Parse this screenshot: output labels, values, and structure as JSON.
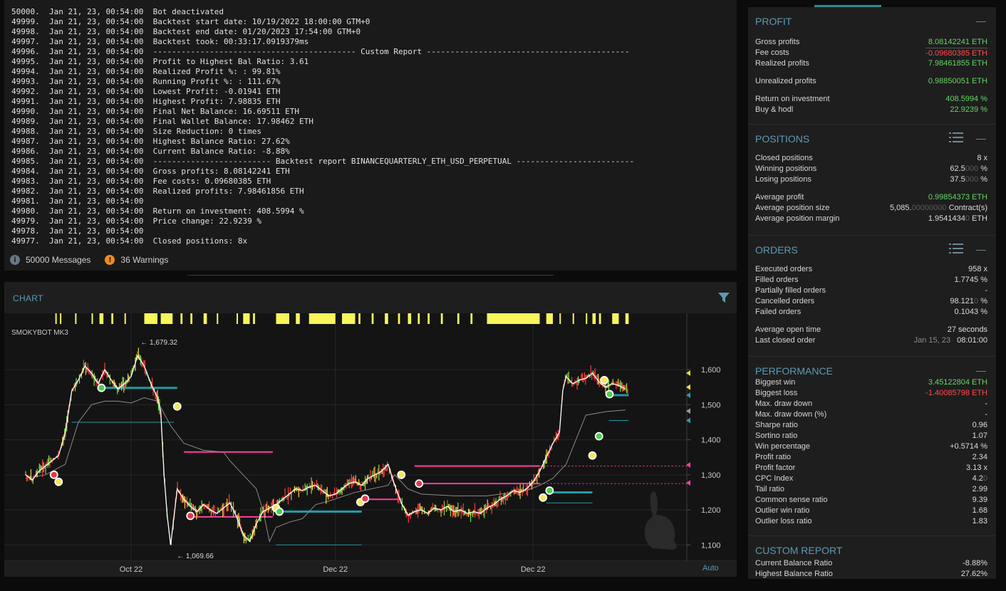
{
  "console": {
    "lines": [
      "50000.  Jan 21, 23, 00:54:00  Bot deactivated",
      "49999.  Jan 21, 23, 00:54:00  Backtest start date: 10/19/2022 18:00:00 GTM+0",
      "49998.  Jan 21, 23, 00:54:00  Backtest end date: 01/20/2023 17:54:00 GTM+0",
      "49997.  Jan 21, 23, 00:54:00  Backtest took: 00:33:17.0919379ms",
      "49996.  Jan 21, 23, 00:54:00  ------------------------------------------- Custom Report -------------------------------------------",
      "49995.  Jan 21, 23, 00:54:00  Profit to Highest Bal Ratio: 3.61",
      "49994.  Jan 21, 23, 00:54:00  Realized Profit %: : 99.81%",
      "49993.  Jan 21, 23, 00:54:00  Running Profit %: : 111.67%",
      "49992.  Jan 21, 23, 00:54:00  Lowest Profit: -0.01941 ETH",
      "49991.  Jan 21, 23, 00:54:00  Highest Profit: 7.98835 ETH",
      "49990.  Jan 21, 23, 00:54:00  Final Net Balance: 16.69511 ETH",
      "49989.  Jan 21, 23, 00:54:00  Final Wallet Balance: 17.98462 ETH",
      "49988.  Jan 21, 23, 00:54:00  Size Reduction: 0 times",
      "49987.  Jan 21, 23, 00:54:00  Highest Balance Ratio: 27.62%",
      "49986.  Jan 21, 23, 00:54:00  Current Balance Ratio: -8.88%",
      "49985.  Jan 21, 23, 00:54:00  ------------------------- Backtest report BINANCEQUARTERLY_ETH_USD_PERPETUAL -------------------------",
      "49984.  Jan 21, 23, 00:54:00  Gross profits: 8.08142241 ETH",
      "49983.  Jan 21, 23, 00:54:00  Fee costs: 0.09680385 ETH",
      "49982.  Jan 21, 23, 00:54:00  Realized profits: 7.98461856 ETH",
      "49981.  Jan 21, 23, 00:54:00",
      "49980.  Jan 21, 23, 00:54:00  Return on investment: 408.5994 %",
      "49979.  Jan 21, 23, 00:54:00  Price change: 22.9239 %",
      "49978.  Jan 21, 23, 00:54:00",
      "49977.  Jan 21, 23, 00:54:00  Closed positions: 8x"
    ],
    "messages_label": "50000 Messages",
    "warnings_label": "36 Warnings"
  },
  "chart_panel": {
    "title": "CHART",
    "strategy": "SMOKYBOT MK3",
    "auto_label": "Auto",
    "high_label": "← 1,679.32",
    "low_label": "← 1,069.66"
  },
  "chart_data": {
    "type": "line",
    "title": "SMOKYBOT MK3",
    "ylim": [
      1060,
      1720
    ],
    "y_ticks": [
      1100,
      1200,
      1300,
      1400,
      1500,
      1600
    ],
    "y_tick_labels": [
      "1,100",
      "1,200",
      "1,300",
      "1,400",
      "1,500",
      "1,600"
    ],
    "x_tick_labels": [
      "Oct 22",
      "Dec 22",
      "Dec 22"
    ],
    "x_tick_positions": [
      0.16,
      0.47,
      0.77
    ],
    "annotations": {
      "high": 1679.32,
      "low": 1069.66
    },
    "price_series": [
      [
        0.0,
        1300
      ],
      [
        0.01,
        1285
      ],
      [
        0.02,
        1310
      ],
      [
        0.03,
        1325
      ],
      [
        0.04,
        1340
      ],
      [
        0.05,
        1355
      ],
      [
        0.06,
        1420
      ],
      [
        0.07,
        1540
      ],
      [
        0.08,
        1570
      ],
      [
        0.09,
        1610
      ],
      [
        0.1,
        1590
      ],
      [
        0.11,
        1560
      ],
      [
        0.12,
        1600
      ],
      [
        0.13,
        1570
      ],
      [
        0.14,
        1545
      ],
      [
        0.15,
        1560
      ],
      [
        0.16,
        1580
      ],
      [
        0.17,
        1640
      ],
      [
        0.18,
        1610
      ],
      [
        0.19,
        1560
      ],
      [
        0.2,
        1520
      ],
      [
        0.205,
        1480
      ],
      [
        0.21,
        1300
      ],
      [
        0.215,
        1180
      ],
      [
        0.22,
        1100
      ],
      [
        0.23,
        1260
      ],
      [
        0.24,
        1230
      ],
      [
        0.25,
        1210
      ],
      [
        0.26,
        1195
      ],
      [
        0.27,
        1215
      ],
      [
        0.28,
        1200
      ],
      [
        0.29,
        1190
      ],
      [
        0.3,
        1205
      ],
      [
        0.31,
        1220
      ],
      [
        0.32,
        1180
      ],
      [
        0.33,
        1130
      ],
      [
        0.34,
        1110
      ],
      [
        0.35,
        1160
      ],
      [
        0.36,
        1195
      ],
      [
        0.37,
        1205
      ],
      [
        0.38,
        1215
      ],
      [
        0.39,
        1230
      ],
      [
        0.4,
        1245
      ],
      [
        0.41,
        1260
      ],
      [
        0.42,
        1255
      ],
      [
        0.43,
        1265
      ],
      [
        0.44,
        1270
      ],
      [
        0.45,
        1255
      ],
      [
        0.46,
        1240
      ],
      [
        0.47,
        1245
      ],
      [
        0.48,
        1260
      ],
      [
        0.49,
        1275
      ],
      [
        0.5,
        1280
      ],
      [
        0.51,
        1270
      ],
      [
        0.52,
        1290
      ],
      [
        0.53,
        1300
      ],
      [
        0.54,
        1310
      ],
      [
        0.55,
        1330
      ],
      [
        0.555,
        1300
      ],
      [
        0.56,
        1270
      ],
      [
        0.57,
        1220
      ],
      [
        0.58,
        1185
      ],
      [
        0.59,
        1195
      ],
      [
        0.6,
        1200
      ],
      [
        0.61,
        1190
      ],
      [
        0.62,
        1205
      ],
      [
        0.63,
        1200
      ],
      [
        0.64,
        1210
      ],
      [
        0.65,
        1195
      ],
      [
        0.66,
        1200
      ],
      [
        0.67,
        1190
      ],
      [
        0.68,
        1195
      ],
      [
        0.69,
        1190
      ],
      [
        0.7,
        1205
      ],
      [
        0.71,
        1215
      ],
      [
        0.72,
        1230
      ],
      [
        0.73,
        1240
      ],
      [
        0.74,
        1255
      ],
      [
        0.75,
        1250
      ],
      [
        0.76,
        1260
      ],
      [
        0.77,
        1280
      ],
      [
        0.78,
        1310
      ],
      [
        0.79,
        1350
      ],
      [
        0.8,
        1390
      ],
      [
        0.81,
        1420
      ],
      [
        0.815,
        1540
      ],
      [
        0.82,
        1580
      ],
      [
        0.83,
        1560
      ],
      [
        0.84,
        1570
      ],
      [
        0.85,
        1575
      ],
      [
        0.86,
        1590
      ],
      [
        0.87,
        1565
      ],
      [
        0.88,
        1550
      ],
      [
        0.89,
        1560
      ],
      [
        0.9,
        1555
      ],
      [
        0.91,
        1545
      ]
    ],
    "slow_series": [
      [
        0.0,
        1290
      ],
      [
        0.03,
        1300
      ],
      [
        0.06,
        1330
      ],
      [
        0.08,
        1450
      ],
      [
        0.1,
        1500
      ],
      [
        0.12,
        1510
      ],
      [
        0.14,
        1510
      ],
      [
        0.16,
        1505
      ],
      [
        0.18,
        1520
      ],
      [
        0.2,
        1510
      ],
      [
        0.22,
        1440
      ],
      [
        0.24,
        1390
      ],
      [
        0.27,
        1370
      ],
      [
        0.3,
        1365
      ],
      [
        0.31,
        1340
      ],
      [
        0.33,
        1300
      ],
      [
        0.35,
        1260
      ],
      [
        0.36,
        1200
      ],
      [
        0.37,
        1110
      ],
      [
        0.38,
        1150
      ],
      [
        0.4,
        1165
      ],
      [
        0.42,
        1175
      ],
      [
        0.44,
        1215
      ],
      [
        0.46,
        1225
      ],
      [
        0.5,
        1250
      ],
      [
        0.55,
        1270
      ],
      [
        0.56,
        1300
      ],
      [
        0.58,
        1260
      ],
      [
        0.6,
        1245
      ],
      [
        0.65,
        1240
      ],
      [
        0.7,
        1240
      ],
      [
        0.74,
        1250
      ],
      [
        0.76,
        1255
      ],
      [
        0.78,
        1270
      ],
      [
        0.8,
        1290
      ],
      [
        0.82,
        1330
      ],
      [
        0.85,
        1470
      ],
      [
        0.88,
        1480
      ],
      [
        0.91,
        1485
      ]
    ],
    "levels": [
      {
        "kind": "entry",
        "y": 1548,
        "x0": 0.115,
        "x1": 0.23
      },
      {
        "kind": "stop",
        "y": 1365,
        "x0": 0.24,
        "x1": 0.375
      },
      {
        "kind": "stop",
        "y": 1180,
        "x0": 0.245,
        "x1": 0.375
      },
      {
        "kind": "entry",
        "y": 1195,
        "x0": 0.385,
        "x1": 0.51
      },
      {
        "kind": "stop",
        "y": 1230,
        "x0": 0.515,
        "x1": 0.57
      },
      {
        "kind": "stop",
        "y": 1325,
        "x0": 0.59,
        "x1": 0.78
      },
      {
        "kind": "stop",
        "y": 1275,
        "x0": 0.595,
        "x1": 0.78
      },
      {
        "kind": "entry",
        "y": 1250,
        "x0": 0.795,
        "x1": 0.86
      },
      {
        "kind": "entry",
        "y": 1527,
        "x0": 0.885,
        "x1": 0.915
      }
    ],
    "markers": [
      {
        "kind": "short",
        "x": 0.043,
        "y": 1300
      },
      {
        "kind": "long",
        "x": 0.05,
        "y": 1280
      },
      {
        "kind": "entry",
        "x": 0.115,
        "y": 1548
      },
      {
        "kind": "long",
        "x": 0.23,
        "y": 1495
      },
      {
        "kind": "short",
        "x": 0.25,
        "y": 1183
      },
      {
        "kind": "long",
        "x": 0.38,
        "y": 1205
      },
      {
        "kind": "entry",
        "x": 0.385,
        "y": 1195
      },
      {
        "kind": "long",
        "x": 0.508,
        "y": 1222
      },
      {
        "kind": "short",
        "x": 0.515,
        "y": 1232
      },
      {
        "kind": "long",
        "x": 0.57,
        "y": 1300
      },
      {
        "kind": "short",
        "x": 0.597,
        "y": 1275
      },
      {
        "kind": "long",
        "x": 0.785,
        "y": 1235
      },
      {
        "kind": "entry",
        "x": 0.795,
        "y": 1255
      },
      {
        "kind": "long",
        "x": 0.86,
        "y": 1355
      },
      {
        "kind": "entry",
        "x": 0.87,
        "y": 1410
      },
      {
        "kind": "long",
        "x": 0.878,
        "y": 1570
      },
      {
        "kind": "entry",
        "x": 0.886,
        "y": 1530
      }
    ],
    "price_tags": [
      {
        "y": 1590,
        "color": "#e8e23a"
      },
      {
        "y": 1550,
        "color": "#e8e23a"
      },
      {
        "y": 1527,
        "color": "#2b9ca6"
      },
      {
        "y": 1482,
        "color": "#9a9a9a"
      },
      {
        "y": 1455,
        "color": "#2b9ca6"
      },
      {
        "y": 1328,
        "color": "#ff3fa0"
      },
      {
        "y": 1277,
        "color": "#ff3fa0"
      }
    ],
    "signal_bars": [
      [
        0.045,
        0.047
      ],
      [
        0.052,
        0.054
      ],
      [
        0.075,
        0.077
      ],
      [
        0.1,
        0.102
      ],
      [
        0.112,
        0.118
      ],
      [
        0.13,
        0.133
      ],
      [
        0.15,
        0.152
      ],
      [
        0.18,
        0.2
      ],
      [
        0.205,
        0.223
      ],
      [
        0.235,
        0.238
      ],
      [
        0.25,
        0.253
      ],
      [
        0.27,
        0.275
      ],
      [
        0.29,
        0.292
      ],
      [
        0.32,
        0.322
      ],
      [
        0.33,
        0.34
      ],
      [
        0.345,
        0.348
      ],
      [
        0.38,
        0.4
      ],
      [
        0.41,
        0.416
      ],
      [
        0.43,
        0.47
      ],
      [
        0.48,
        0.5
      ],
      [
        0.505,
        0.508
      ],
      [
        0.525,
        0.528
      ],
      [
        0.545,
        0.55
      ],
      [
        0.565,
        0.568
      ],
      [
        0.58,
        0.585
      ],
      [
        0.595,
        0.598
      ],
      [
        0.61,
        0.613
      ],
      [
        0.63,
        0.633
      ],
      [
        0.655,
        0.658
      ],
      [
        0.675,
        0.678
      ],
      [
        0.7,
        0.78
      ],
      [
        0.79,
        0.8
      ],
      [
        0.81,
        0.812
      ],
      [
        0.83,
        0.832
      ],
      [
        0.85,
        0.852
      ],
      [
        0.86,
        0.865
      ],
      [
        0.87,
        0.873
      ],
      [
        0.89,
        0.9
      ],
      [
        0.91,
        0.915
      ]
    ]
  },
  "right_panel": {
    "profit": {
      "title": "PROFIT",
      "rows": [
        {
          "label": "Gross profits",
          "value": "8.08142241 ETH"
        },
        {
          "label": "Fee costs",
          "value": "-0.09680385 ETH"
        },
        {
          "label": "Realized profits",
          "value": "7.98461855 ETH"
        },
        {
          "label": "Unrealized profits",
          "value": "0.98850051 ETH"
        },
        {
          "label": "Return on investment",
          "value": "408.5994 %"
        },
        {
          "label": "Buy & hodl",
          "value": "22.9239 %"
        }
      ]
    },
    "positions": {
      "title": "POSITIONS",
      "rows": [
        {
          "label": "Closed positions",
          "value": "8 x"
        },
        {
          "label": "Winning positions",
          "value": "62.5",
          "faded": "000",
          "unit": " %"
        },
        {
          "label": "Losing positions",
          "value": "37.5",
          "faded": "000",
          "unit": " %"
        },
        {
          "label": "Average profit",
          "value": "0.99854373 ETH"
        },
        {
          "label": "Average position size",
          "value": "5,085.",
          "faded": "00000000",
          "unit": " Contract(s)"
        },
        {
          "label": "Average position margin",
          "value": "1.9541434",
          "faded": "0",
          "unit": " ETH"
        }
      ]
    },
    "orders": {
      "title": "ORDERS",
      "rows": [
        {
          "label": "Executed orders",
          "value": "958 x"
        },
        {
          "label": "Filled orders",
          "value": "1.7745 %"
        },
        {
          "label": "Partially filled orders",
          "value": "-"
        },
        {
          "label": "Cancelled orders",
          "value": "98.121",
          "faded": "0",
          "unit": " %"
        },
        {
          "label": "Failed orders",
          "value": "0.1043 %"
        },
        {
          "label": "Average open time",
          "value": "27 seconds"
        },
        {
          "label": "Last closed order",
          "value": "Jan 15, 23",
          "unit": "   08:01:00"
        }
      ]
    },
    "performance": {
      "title": "PERFORMANCE",
      "rows": [
        {
          "label": "Biggest win",
          "value": "3.45122804 ETH"
        },
        {
          "label": "Biggest loss",
          "value": "-1.40085798 ETH"
        },
        {
          "label": "Max. draw down",
          "value": "-"
        },
        {
          "label": "Max. draw down (%)",
          "value": "-"
        },
        {
          "label": "Sharpe ratio",
          "value": "0.96"
        },
        {
          "label": "Sortino ratio",
          "value": "1.07"
        },
        {
          "label": "Win percentage",
          "value": "+0.5714 %"
        },
        {
          "label": "Profit ratio",
          "value": "2.34"
        },
        {
          "label": "Profit factor",
          "value": "3.13 x"
        },
        {
          "label": "CPC Index",
          "value": "4.2",
          "faded": "0"
        },
        {
          "label": "Tail ratio",
          "value": "2.99"
        },
        {
          "label": "Common sense ratio",
          "value": "9.39"
        },
        {
          "label": "Outlier win ratio",
          "value": "1.68"
        },
        {
          "label": "Outlier loss ratio",
          "value": "1.83"
        }
      ]
    },
    "custom": {
      "title": "CUSTOM REPORT",
      "rows": [
        {
          "label": "Current Balance Ratio",
          "value": "-8.88%"
        },
        {
          "label": "Highest Balance Ratio",
          "value": "27.62%"
        }
      ]
    }
  },
  "colors": {
    "positive": "#66d466",
    "negative": "#ff4b4b",
    "accent": "#5d9ab4",
    "entry_level": "#1f9aa4",
    "stop_level": "#ff3fa0",
    "signal": "#f7f55a"
  },
  "icons": [
    "info-icon",
    "warning-icon",
    "filter-icon",
    "list-icon",
    "minimize-icon",
    "rabbit-watermark"
  ]
}
